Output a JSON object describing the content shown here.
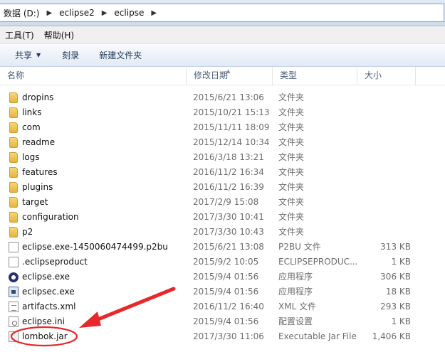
{
  "address_bar": {
    "crumbs": [
      "数据 (D:)",
      "eclipse2",
      "eclipse"
    ]
  },
  "menu": {
    "items": [
      {
        "label": "工具(T)"
      },
      {
        "label": "帮助(H)"
      }
    ]
  },
  "toolbar": {
    "share_label": "共享",
    "burn_label": "刻录",
    "new_folder_label": "新建文件夹"
  },
  "columns": {
    "name": "名称",
    "modified": "修改日期",
    "type": "类型",
    "size": "大小"
  },
  "files": [
    {
      "name": "dropins",
      "date": "2015/6/21 13:06",
      "type": "文件夹",
      "size": "",
      "icon": "folder-icon"
    },
    {
      "name": "links",
      "date": "2015/10/21 15:13",
      "type": "文件夹",
      "size": "",
      "icon": "folder-icon"
    },
    {
      "name": "com",
      "date": "2015/11/11 18:09",
      "type": "文件夹",
      "size": "",
      "icon": "folder-icon"
    },
    {
      "name": "readme",
      "date": "2015/12/14 10:34",
      "type": "文件夹",
      "size": "",
      "icon": "folder-icon"
    },
    {
      "name": "logs",
      "date": "2016/3/18 13:21",
      "type": "文件夹",
      "size": "",
      "icon": "folder-icon"
    },
    {
      "name": "features",
      "date": "2016/11/2 16:34",
      "type": "文件夹",
      "size": "",
      "icon": "folder-icon"
    },
    {
      "name": "plugins",
      "date": "2016/11/2 16:39",
      "type": "文件夹",
      "size": "",
      "icon": "folder-icon"
    },
    {
      "name": "target",
      "date": "2017/2/9 15:08",
      "type": "文件夹",
      "size": "",
      "icon": "folder-icon"
    },
    {
      "name": "configuration",
      "date": "2017/3/30 10:41",
      "type": "文件夹",
      "size": "",
      "icon": "folder-icon"
    },
    {
      "name": "p2",
      "date": "2017/3/30 10:43",
      "type": "文件夹",
      "size": "",
      "icon": "folder-icon"
    },
    {
      "name": "eclipse.exe-1450060474499.p2bu",
      "date": "2015/6/21 13:08",
      "type": "P2BU 文件",
      "size": "313 KB",
      "icon": "file-icon"
    },
    {
      "name": ".eclipseproduct",
      "date": "2015/9/2 10:05",
      "type": "ECLIPSEPRODUC...",
      "size": "1 KB",
      "icon": "file-icon"
    },
    {
      "name": "eclipse.exe",
      "date": "2015/9/4 01:56",
      "type": "应用程序",
      "size": "306 KB",
      "icon": "eclipse-app-icon"
    },
    {
      "name": "eclipsec.exe",
      "date": "2015/9/4 01:56",
      "type": "应用程序",
      "size": "18 KB",
      "icon": "console-app-icon"
    },
    {
      "name": "artifacts.xml",
      "date": "2016/11/2 16:40",
      "type": "XML 文件",
      "size": "293 KB",
      "icon": "xml-file-icon"
    },
    {
      "name": "eclipse.ini",
      "date": "2015/9/4 01:56",
      "type": "配置设置",
      "size": "1 KB",
      "icon": "settings-file-icon"
    },
    {
      "name": "lombok.jar",
      "date": "2017/3/30 11:06",
      "type": "Executable Jar File",
      "size": "1,406 KB",
      "icon": "jar-file-icon"
    }
  ],
  "annotation_color": "#e8282b"
}
